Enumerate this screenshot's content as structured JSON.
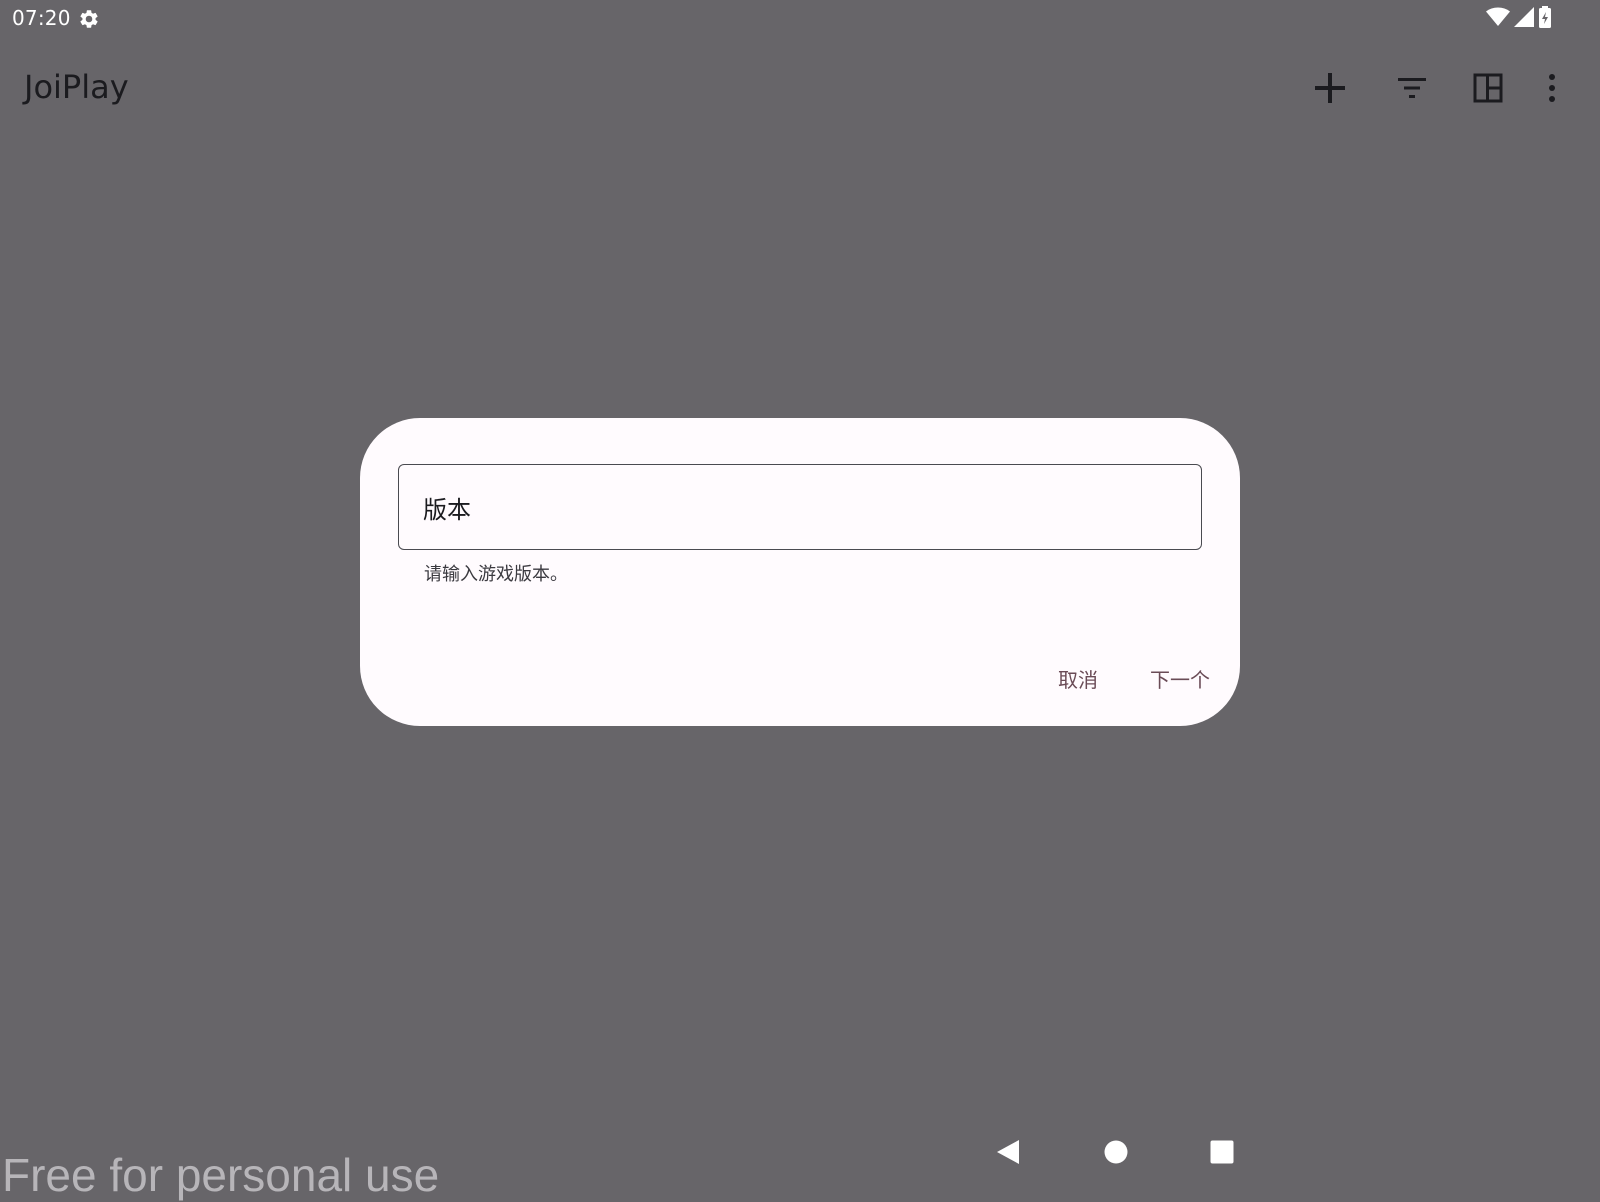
{
  "status_bar": {
    "time": "07:20",
    "icons": [
      "settings-icon",
      "wifi-icon",
      "signal-icon",
      "battery-charging-icon"
    ]
  },
  "app_bar": {
    "title": "JoiPlay",
    "actions": [
      "add-icon",
      "filter-icon",
      "layout-icon",
      "more-vert-icon"
    ]
  },
  "dialog": {
    "field_value": "版本",
    "helper_text": "请输入游戏版本。",
    "cancel_label": "取消",
    "next_label": "下一个"
  },
  "nav_bar": {
    "buttons": [
      "back-icon",
      "home-icon",
      "recents-icon"
    ]
  },
  "watermark": "Free for personal use",
  "colors": {
    "scrim_background": "#676569",
    "dialog_surface": "#fffbfe",
    "dialog_button_text": "#6a4b56",
    "toolbar_icon": "#1b1b1f"
  }
}
